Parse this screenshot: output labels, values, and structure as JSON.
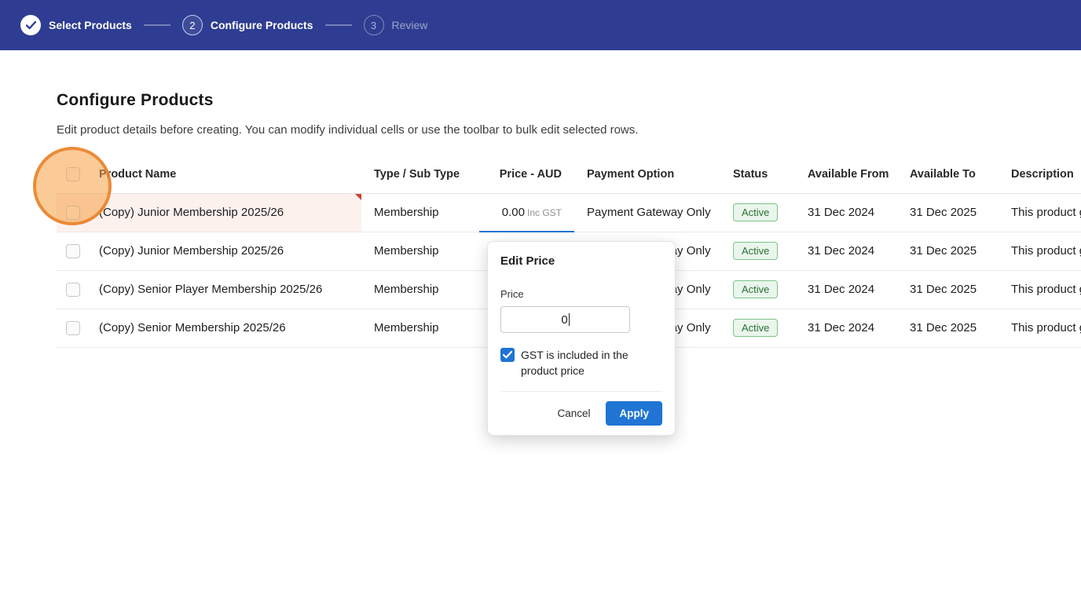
{
  "stepper": {
    "steps": [
      {
        "number": "1",
        "label": "Select Products",
        "state": "complete"
      },
      {
        "number": "2",
        "label": "Configure Products",
        "state": "active"
      },
      {
        "number": "3",
        "label": "Review",
        "state": "upcoming"
      }
    ]
  },
  "page": {
    "title": "Configure Products",
    "subtitle": "Edit product details before creating. You can modify individual cells or use the toolbar to bulk edit selected rows."
  },
  "table": {
    "headers": {
      "product_name": "Product Name",
      "type": "Type / Sub Type",
      "price": "Price - AUD",
      "payment": "Payment Option",
      "status": "Status",
      "available_from": "Available From",
      "available_to": "Available To",
      "description": "Description"
    },
    "rows": [
      {
        "product_name": "(Copy) Junior Membership 2025/26",
        "type": "Membership",
        "price": "0.00",
        "price_suffix": "Inc GST",
        "payment": "Payment Gateway Only",
        "status": "Active",
        "available_from": "31 Dec 2024",
        "available_to": "31 Dec 2025",
        "description": "This product g"
      },
      {
        "product_name": "(Copy) Junior Membership 2025/26",
        "type": "Membership",
        "price": "",
        "price_suffix": "",
        "payment": "Payment Gateway Only",
        "status": "Active",
        "available_from": "31 Dec 2024",
        "available_to": "31 Dec 2025",
        "description": "This product g"
      },
      {
        "product_name": "(Copy) Senior Player Membership 2025/26",
        "type": "Membership",
        "price": "",
        "price_suffix": "",
        "payment": "Payment Gateway Only",
        "status": "Active",
        "available_from": "31 Dec 2024",
        "available_to": "31 Dec 2025",
        "description": "This product g"
      },
      {
        "product_name": "(Copy) Senior Membership 2025/26",
        "type": "Membership",
        "price": "",
        "price_suffix": "",
        "payment": "Payment Gateway Only",
        "status": "Active",
        "available_from": "31 Dec 2024",
        "available_to": "31 Dec 2025",
        "description": "This product g"
      }
    ]
  },
  "popover": {
    "title": "Edit Price",
    "price_label": "Price",
    "price_value": "0",
    "gst_label": "GST is included in the product price",
    "cancel_label": "Cancel",
    "apply_label": "Apply"
  },
  "colors": {
    "topbar": "#2e3d92",
    "accent_blue": "#1f74d4",
    "badge_bg": "#eaf6ec",
    "badge_border": "#7cc488",
    "badge_text": "#2a6f35",
    "modified_cell_bg": "#fdf1ee",
    "error_flag": "#d23f31",
    "click_highlight": "#f09e42"
  }
}
